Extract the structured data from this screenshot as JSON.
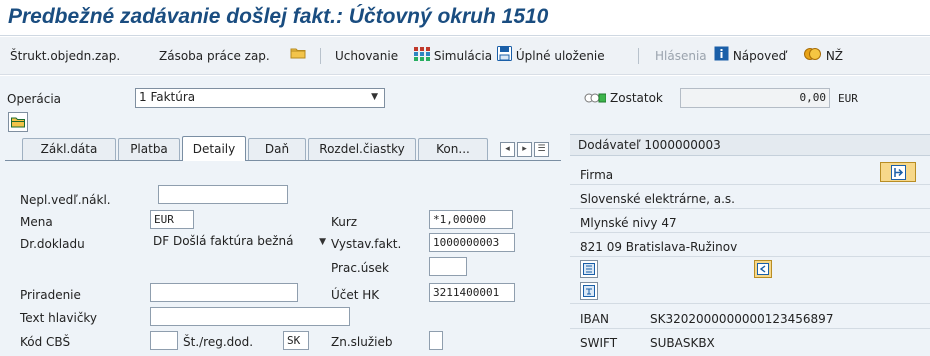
{
  "window": {
    "title": "Predbežné zadávanie došlej fakt.: Účtovný okruh 1510"
  },
  "toolbar": {
    "strukt": "Štrukt.objedn.zap.",
    "zasoba": "Zásoba práce zap.",
    "uchovanie": "Uchovanie",
    "simulacia": "Simulácia",
    "ulozenie": "Úplné uloženie",
    "hlasenia": "Hlásenia",
    "napoved": "Nápoveď",
    "nz": "NŽ"
  },
  "header": {
    "operacia_label": "Operácia",
    "operacia_value": "1 Faktúra",
    "zostatok_label": "Zostatok",
    "zostatok_value": "0,00",
    "zostatok_currency": "EUR"
  },
  "tabs": [
    "Zákl.dáta",
    "Platba",
    "Detaily",
    "Daň",
    "Rozdel.čiastky",
    "Kon..."
  ],
  "form": {
    "nepl_label": "Nepl.vedľ.nákl.",
    "nepl_value": "",
    "mena_label": "Mena",
    "mena_value": "EUR",
    "kurz_label": "Kurz",
    "kurz_value": "*1,00000",
    "drdokladu_label": "Dr.dokladu",
    "drdokladu_value": "DF Došlá faktúra bežná",
    "vystav_label": "Vystav.fakt.",
    "vystav_value": "1000000003",
    "pracusek_label": "Prac.úsek",
    "pracusek_value": "",
    "priradenie_label": "Priradenie",
    "priradenie_value": "",
    "ucethk_label": "Účet HK",
    "ucethk_value": "3211400001",
    "texthl_label": "Text hlavičky",
    "texthl_value": "",
    "kodcbs_label": "Kód CBŠ",
    "kodcbs_value": "",
    "streg_label": "Št./reg.dod.",
    "streg_value": "SK",
    "znsluzieb_label": "Zn.služieb",
    "znsluzieb_value": ""
  },
  "vendor": {
    "title": "Dodávateľ 1000000003",
    "firma": "Firma",
    "name": "Slovenské elektrárne, a.s.",
    "street": "Mlynské nivy 47",
    "city": "821 09 Bratislava-Ružinov",
    "iban_label": "IBAN",
    "iban_value": "SK3202000000000123456897",
    "swift_label": "SWIFT",
    "swift_value": "SUBASKBX"
  },
  "colors": {
    "title": "#1a4d80",
    "accent": "#0a64c8",
    "status_green": "#3cb44b"
  }
}
